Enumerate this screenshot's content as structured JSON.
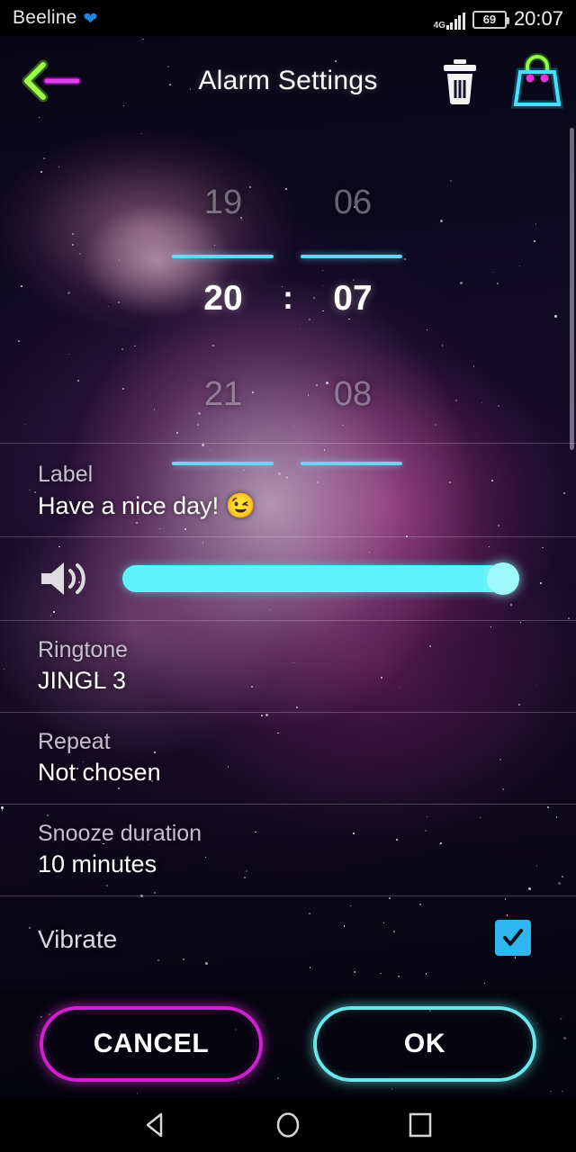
{
  "status_bar": {
    "carrier": "Beeline",
    "heart_icon": "heart-icon",
    "network_type": "4G",
    "battery_level": "69",
    "time": "20:07"
  },
  "header": {
    "title": "Alarm Settings",
    "back_icon": "back-arrow-icon",
    "delete_icon": "trash-icon",
    "shop_icon": "shopping-bag-icon"
  },
  "time_picker": {
    "hours": {
      "previous": "19",
      "selected": "20",
      "next": "21"
    },
    "minutes": {
      "previous": "06",
      "selected": "07",
      "next": "08"
    },
    "separator": ":",
    "accent_color": "#6ed4ef"
  },
  "settings": {
    "label": {
      "title": "Label",
      "value": "Have a nice day! 😉"
    },
    "volume": {
      "icon": "speaker-icon",
      "value": "100",
      "fill_color": "#5ef2fa"
    },
    "ringtone": {
      "title": "Ringtone",
      "value": "JINGL 3"
    },
    "repeat": {
      "title": "Repeat",
      "value": "Not chosen"
    },
    "snooze": {
      "title": "Snooze duration",
      "value": "10 minutes"
    },
    "vibrate": {
      "title": "Vibrate",
      "checked": "✓",
      "checkbox_color": "#2eb6ee"
    }
  },
  "footer": {
    "cancel_label": "CANCEL",
    "cancel_color": "#d21fd2",
    "ok_label": "OK",
    "ok_color": "#68e6e8"
  },
  "nav_bar": {
    "back_icon": "nav-back-icon",
    "home_icon": "nav-home-icon",
    "recents_icon": "nav-recents-icon"
  }
}
